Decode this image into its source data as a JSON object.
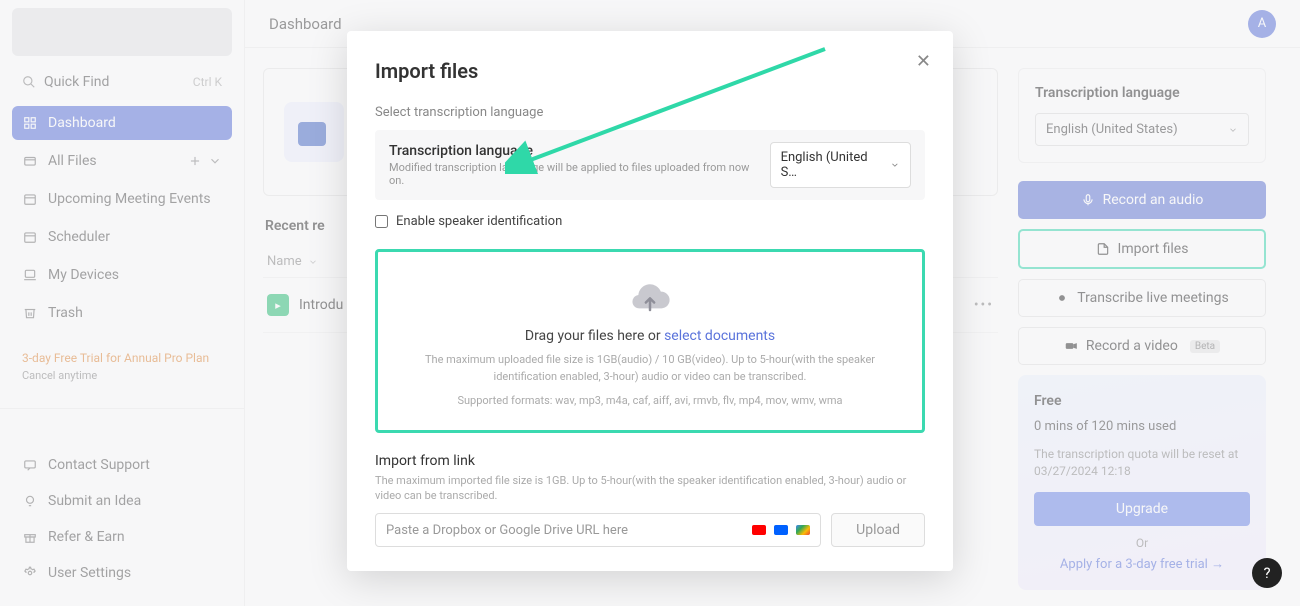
{
  "topbar": {
    "title": "Dashboard",
    "avatar_initial": "A"
  },
  "sidebar": {
    "quick_find": "Quick Find",
    "quick_find_kbd": "Ctrl   K",
    "items": [
      {
        "label": "Dashboard"
      },
      {
        "label": "All Files"
      },
      {
        "label": "Upcoming Meeting Events"
      },
      {
        "label": "Scheduler"
      },
      {
        "label": "My Devices"
      },
      {
        "label": "Trash"
      }
    ],
    "trial_title": "3-day Free Trial for Annual Pro Plan",
    "trial_cancel": "Cancel anytime",
    "bottom": [
      {
        "label": "Contact Support"
      },
      {
        "label": "Submit an Idea"
      },
      {
        "label": "Refer & Earn"
      },
      {
        "label": "User Settings"
      }
    ]
  },
  "center": {
    "recent_heading": "Recent re",
    "col_name": "Name",
    "row1": "Introdu"
  },
  "right": {
    "lang_title": "Transcription language",
    "lang_value": "English (United States)",
    "record_audio": "Record an audio",
    "import_files": "Import files",
    "transcribe_live": "Transcribe live meetings",
    "record_video": "Record a video",
    "record_video_badge": "Beta",
    "plan": "Free",
    "usage": "0 mins of 120 mins used",
    "quota": "The transcription quota will be reset at 03/27/2024 12:18",
    "upgrade": "Upgrade",
    "or": "Or",
    "apply": "Apply for a 3-day free trial  →"
  },
  "modal": {
    "title": "Import files",
    "select_lang": "Select transcription language",
    "lang_name": "Transcription language",
    "lang_hint": "Modified transcription language will be applied to files uploaded from now on.",
    "lang_select_value": "English (United S…",
    "speaker": "Enable speaker identification",
    "drop_main_pre": "Drag your files here or  ",
    "drop_main_link": "select documents",
    "drop_fine1": "The maximum uploaded file size is 1GB(audio) / 10 GB(video). Up to 5-hour(with the speaker identification enabled, 3-hour) audio or video can be transcribed.",
    "drop_fine2": "Supported formats: wav, mp3, m4a, caf, aiff, avi, rmvb, flv, mp4, mov, wmv, wma",
    "import_link_title": "Import from link",
    "import_link_fine": "The maximum imported file size is 1GB. Up to 5-hour(with the speaker identification enabled, 3-hour) audio or video can be transcribed.",
    "url_placeholder": "Paste a Dropbox or Google Drive URL here",
    "upload": "Upload"
  }
}
